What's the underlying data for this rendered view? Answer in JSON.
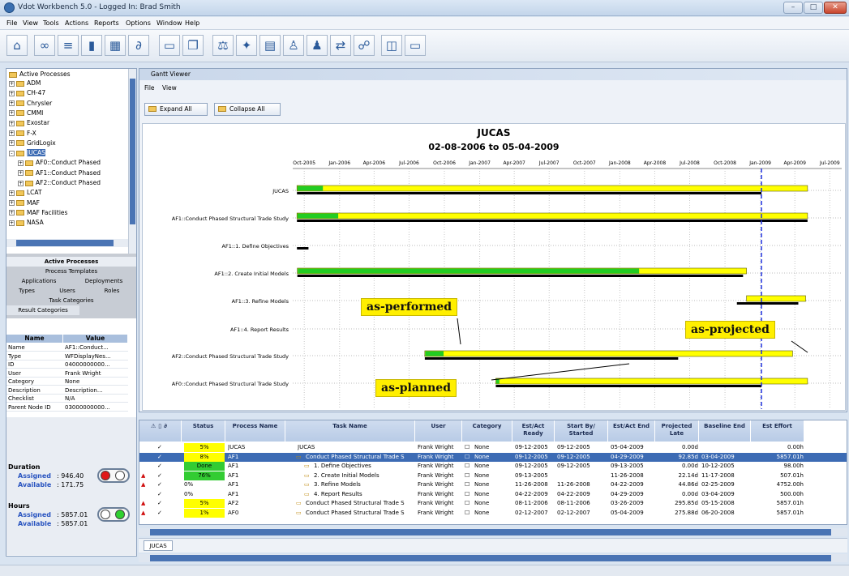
{
  "window": {
    "title": "Vdot Workbench 5.0 - Logged In: Brad Smith",
    "min": "–",
    "max": "□",
    "close": "✕"
  },
  "menu": [
    "File",
    "View",
    "Tools",
    "Actions",
    "Reports",
    "Options",
    "Window",
    "Help"
  ],
  "toolbar_icons": [
    "home-icon",
    "glasses-icon",
    "hierarchy-icon",
    "bar-chart-icon",
    "calendar-icon",
    "link-icon",
    "folder-open-icon",
    "copy-icon",
    "scale-icon",
    "tools-icon",
    "document-icon",
    "user-icon",
    "users-icon",
    "transfer-icon",
    "group-icon",
    "window-icon",
    "screen-icon"
  ],
  "tree": {
    "root": "Active Processes",
    "items": [
      {
        "label": "ADM",
        "level": 1,
        "exp": "+"
      },
      {
        "label": "CH-47",
        "level": 1,
        "exp": "+"
      },
      {
        "label": "Chrysler",
        "level": 1,
        "exp": "+"
      },
      {
        "label": "CMMI",
        "level": 1,
        "exp": "+"
      },
      {
        "label": "Exostar",
        "level": 1,
        "exp": "+"
      },
      {
        "label": "F-X",
        "level": 1,
        "exp": "+"
      },
      {
        "label": "GridLogix",
        "level": 1,
        "exp": "+"
      },
      {
        "label": "JUCAS",
        "level": 1,
        "exp": "-",
        "selected": true
      },
      {
        "label": "AF0::Conduct Phased",
        "level": 2,
        "exp": "+"
      },
      {
        "label": "AF1::Conduct Phased",
        "level": 2,
        "exp": "+"
      },
      {
        "label": "AF2::Conduct Phased",
        "level": 2,
        "exp": "+"
      },
      {
        "label": "LCAT",
        "level": 1,
        "exp": "+"
      },
      {
        "label": "MAF",
        "level": 1,
        "exp": "+"
      },
      {
        "label": "MAF Facilities",
        "level": 1,
        "exp": "+"
      },
      {
        "label": "NASA",
        "level": 1,
        "exp": "+"
      }
    ]
  },
  "left_tabs": {
    "active_processes": "Active Processes",
    "process_templates": "Process Templates",
    "applications": "Applications",
    "deployments": "Deployments",
    "types": "Types",
    "users": "Users",
    "roles": "Roles",
    "task_categories": "Task Categories",
    "result_categories": "Result Categories"
  },
  "props": {
    "col_name": "Name",
    "col_value": "Value",
    "rows": [
      [
        "Name",
        "AF1::Conduct..."
      ],
      [
        "Type",
        "WFDisplayNes..."
      ],
      [
        "ID",
        "04000000000..."
      ],
      [
        "User",
        "Frank Wright"
      ],
      [
        "Category",
        "None"
      ],
      [
        "Description",
        "Description..."
      ],
      [
        "Checklist",
        "N/A"
      ],
      [
        "Parent Node ID",
        "03000000000..."
      ]
    ]
  },
  "duration": {
    "title": "Duration",
    "assigned_label": "Assigned",
    "assigned": ": 946.40",
    "available_label": "Available",
    "available": ": 171.75"
  },
  "hours": {
    "title": "Hours",
    "assigned_label": "Assigned",
    "assigned": ": 5857.01",
    "available_label": "Available",
    "available": ": 5857.01"
  },
  "gantt_window": {
    "title": "Gantt Viewer",
    "menu_file": "File",
    "menu_view": "View",
    "expand_all": "Expand All",
    "collapse_all": "Collapse All"
  },
  "chart_data": {
    "type": "gantt",
    "title": "JUCAS",
    "subtitle": "02-08-2006 to 05-04-2009",
    "ticks": [
      "Oct-2005",
      "Jan-2006",
      "Apr-2006",
      "Jul-2006",
      "Oct-2006",
      "Jan-2007",
      "Apr-2007",
      "Jul-2007",
      "Oct-2007",
      "Jan-2008",
      "Apr-2008",
      "Jul-2008",
      "Oct-2008",
      "Jan-2009",
      "Apr-2009",
      "Jul-2009"
    ],
    "tasks": [
      {
        "label": "JUCAS",
        "performed": [
          "2005-09-12",
          "2009-05-04"
        ],
        "complete": 0.05,
        "planned": [
          "2005-09-12",
          "2009-01-04"
        ]
      },
      {
        "label": "AF1::Conduct Phased Structural Trade Study",
        "performed": [
          "2005-09-12",
          "2009-05-04"
        ],
        "complete": 0.08,
        "planned": [
          "2005-09-12",
          "2009-05-04"
        ]
      },
      {
        "label": "AF1::1. Define Objectives",
        "performed": null,
        "complete": 0,
        "planned": [
          "2005-09-12",
          "2005-10-12"
        ]
      },
      {
        "label": "AF1::2. Create Initial Models",
        "performed": [
          "2005-09-13",
          "2008-11-26"
        ],
        "complete": 0.76,
        "planned": [
          "2005-09-13",
          "2008-11-17"
        ]
      },
      {
        "label": "AF1::3. Refine Models",
        "performed": [
          "2008-11-26",
          "2009-04-29"
        ],
        "complete": 0,
        "planned": [
          "2008-11-01",
          "2009-04-10"
        ]
      },
      {
        "label": "AF1::4. Report Results",
        "performed": null,
        "complete": 0,
        "planned": null
      },
      {
        "label": "AF2::Conduct Phased Structural Trade Study",
        "performed": [
          "2006-08-11",
          "2009-03-26"
        ],
        "complete": 0.05,
        "planned": [
          "2006-08-11",
          "2008-06-01"
        ]
      },
      {
        "label": "AF0::Conduct Phased Structural Trade Study",
        "performed": [
          "2007-02-12",
          "2009-05-04"
        ],
        "complete": 0.01,
        "planned": [
          "2007-02-12",
          "2009-01-04"
        ]
      }
    ],
    "today_line": "2009-01-04",
    "callouts": [
      "as-performed",
      "as-projected",
      "as-planned"
    ]
  },
  "grid": {
    "headers": [
      "Status",
      "Process Name",
      "Task Name",
      "User",
      "Category",
      "Est/Act Ready",
      "Start By/ Started",
      "Est/Act End",
      "Projected Late",
      "Baseline End",
      "Est Effort"
    ],
    "rows": [
      {
        "status": "5%",
        "process": "JUCAS",
        "task": "JUCAS",
        "user": "Frank Wright",
        "category": "None",
        "ready": "09-12-2005",
        "start": "09-12-2005",
        "end": "05-04-2009",
        "late": "0.00d",
        "baseline": "",
        "effort": "0.00h",
        "level": 0
      },
      {
        "status": "8%",
        "process": "AF1",
        "task": "Conduct Phased Structural Trade S",
        "user": "Frank Wright",
        "category": "None",
        "ready": "09-12-2005",
        "start": "09-12-2005",
        "end": "04-29-2009",
        "late": "92.85d",
        "baseline": "03-04-2009",
        "effort": "5857.01h",
        "level": 1,
        "selected": true
      },
      {
        "status": "Done",
        "process": "AF1",
        "task": "1. Define Objectives",
        "user": "Frank Wright",
        "category": "None",
        "ready": "09-12-2005",
        "start": "09-12-2005",
        "end": "09-13-2005",
        "late": "0.00d",
        "baseline": "10-12-2005",
        "effort": "98.00h",
        "level": 2
      },
      {
        "status": "76%",
        "process": "AF1",
        "task": "2. Create Initial Models",
        "user": "Frank Wright",
        "category": "None",
        "ready": "09-13-2005",
        "start": "",
        "end": "11-26-2008",
        "late": "22.14d",
        "baseline": "11-17-2008",
        "effort": "507.01h",
        "level": 2
      },
      {
        "status": "0%",
        "process": "AF1",
        "task": "3. Refine Models",
        "user": "Frank Wright",
        "category": "None",
        "ready": "11-26-2008",
        "start": "11-26-2008",
        "end": "04-22-2009",
        "late": "44.86d",
        "baseline": "02-25-2009",
        "effort": "4752.00h",
        "level": 2
      },
      {
        "status": "0%",
        "process": "AF1",
        "task": "4. Report Results",
        "user": "Frank Wright",
        "category": "None",
        "ready": "04-22-2009",
        "start": "04-22-2009",
        "end": "04-29-2009",
        "late": "0.00d",
        "baseline": "03-04-2009",
        "effort": "500.00h",
        "level": 2
      },
      {
        "status": "5%",
        "process": "AF2",
        "task": "Conduct Phased Structural Trade S",
        "user": "Frank Wright",
        "category": "None",
        "ready": "08-11-2006",
        "start": "08-11-2006",
        "end": "03-26-2009",
        "late": "295.85d",
        "baseline": "05-15-2008",
        "effort": "5857.01h",
        "level": 1
      },
      {
        "status": "1%",
        "process": "AF0",
        "task": "Conduct Phased Structural Trade S",
        "user": "Frank Wright",
        "category": "None",
        "ready": "02-12-2007",
        "start": "02-12-2007",
        "end": "05-04-2009",
        "late": "275.88d",
        "baseline": "06-20-2008",
        "effort": "5857.01h",
        "level": 1
      }
    ]
  },
  "bottom_tab": "JUCAS"
}
